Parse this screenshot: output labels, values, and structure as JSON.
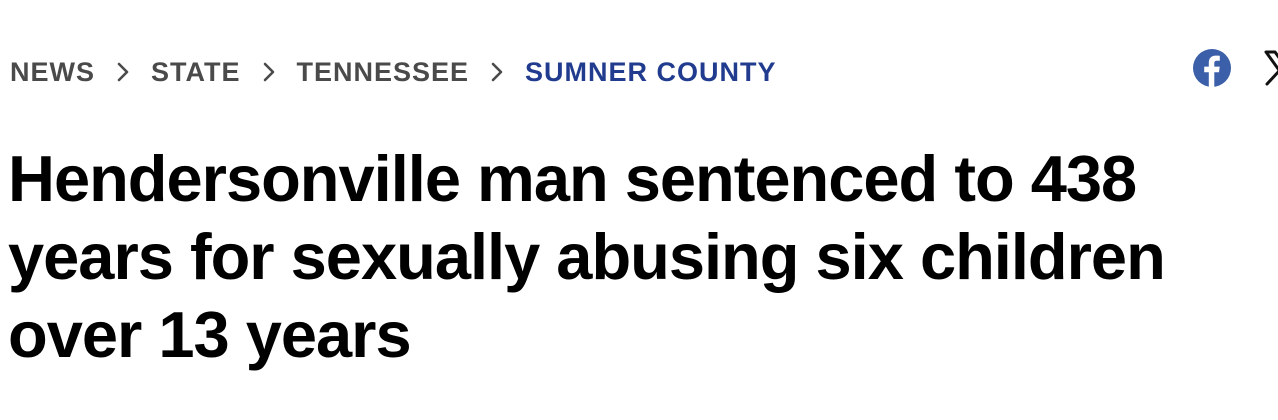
{
  "breadcrumb": {
    "items": [
      {
        "label": "NEWS"
      },
      {
        "label": "STATE"
      },
      {
        "label": "TENNESSEE"
      },
      {
        "label": "SUMNER COUNTY"
      }
    ]
  },
  "share": {
    "icons": [
      "facebook-icon",
      "x-icon"
    ]
  },
  "article": {
    "headline": "Hendersonville man sentenced to 438 years for sexually abusing six children over 13 years"
  },
  "colors": {
    "breadcrumb_text": "#4a4a4a",
    "breadcrumb_current": "#213c8f",
    "facebook": "#3b5fa8",
    "headline": "#000000"
  }
}
